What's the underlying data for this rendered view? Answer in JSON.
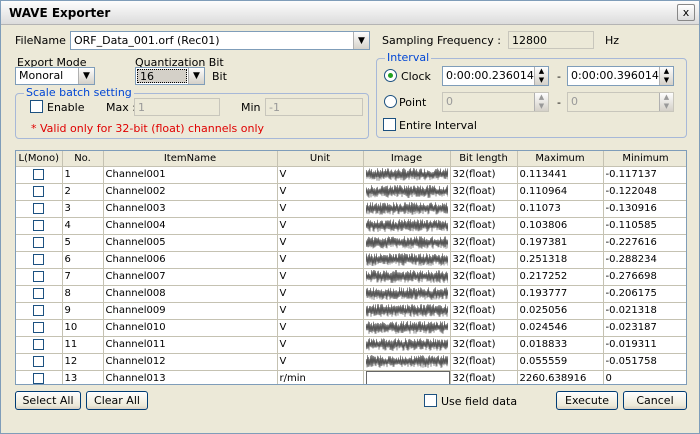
{
  "window": {
    "title": "WAVE Exporter",
    "close_glyph": "x"
  },
  "file": {
    "label": "FileName :",
    "value": "ORF_Data_001.orf (Rec01)"
  },
  "sampling": {
    "label": "Sampling Frequency :",
    "value": "12800",
    "unit": "Hz"
  },
  "export_mode": {
    "label": "Export Mode",
    "value": "Monoral"
  },
  "quant": {
    "label": "Quantization Bit",
    "value": "16",
    "unit": "Bit"
  },
  "scale": {
    "title": "Scale batch setting",
    "enable_label": "Enable",
    "max_label": "Max :",
    "max_value": "1",
    "min_label": "Min :",
    "min_value": "-1",
    "note": "* Valid only for 32-bit (float) channels only"
  },
  "interval": {
    "title": "Interval",
    "clock_label": "Clock",
    "clock_start": "0:00:00.236014",
    "clock_end": "0:00:00.396014",
    "dash": "-",
    "point_label": "Point",
    "point_start": "0",
    "point_end": "0",
    "entire_label": "Entire Interval"
  },
  "table": {
    "headers": [
      "L(Mono)",
      "No.",
      "ItemName",
      "Unit",
      "Image",
      "Bit length",
      "Maximum",
      "Minimum"
    ],
    "rows": [
      {
        "no": "1",
        "name": "Channel001",
        "unit": "V",
        "bits": "32(float)",
        "max": "0.113441",
        "min": "-0.117137"
      },
      {
        "no": "2",
        "name": "Channel002",
        "unit": "V",
        "bits": "32(float)",
        "max": "0.110964",
        "min": "-0.122048"
      },
      {
        "no": "3",
        "name": "Channel003",
        "unit": "V",
        "bits": "32(float)",
        "max": "0.11073",
        "min": "-0.130916"
      },
      {
        "no": "4",
        "name": "Channel004",
        "unit": "V",
        "bits": "32(float)",
        "max": "0.103806",
        "min": "-0.110585"
      },
      {
        "no": "5",
        "name": "Channel005",
        "unit": "V",
        "bits": "32(float)",
        "max": "0.197381",
        "min": "-0.227616"
      },
      {
        "no": "6",
        "name": "Channel006",
        "unit": "V",
        "bits": "32(float)",
        "max": "0.251318",
        "min": "-0.288234"
      },
      {
        "no": "7",
        "name": "Channel007",
        "unit": "V",
        "bits": "32(float)",
        "max": "0.217252",
        "min": "-0.276698"
      },
      {
        "no": "8",
        "name": "Channel008",
        "unit": "V",
        "bits": "32(float)",
        "max": "0.193777",
        "min": "-0.206175"
      },
      {
        "no": "9",
        "name": "Channel009",
        "unit": "V",
        "bits": "32(float)",
        "max": "0.025056",
        "min": "-0.021318"
      },
      {
        "no": "10",
        "name": "Channel010",
        "unit": "V",
        "bits": "32(float)",
        "max": "0.024546",
        "min": "-0.023187"
      },
      {
        "no": "11",
        "name": "Channel011",
        "unit": "V",
        "bits": "32(float)",
        "max": "0.018833",
        "min": "-0.019311"
      },
      {
        "no": "12",
        "name": "Channel012",
        "unit": "V",
        "bits": "32(float)",
        "max": "0.055559",
        "min": "-0.051758"
      },
      {
        "no": "13",
        "name": "Channel013",
        "unit": "r/min",
        "bits": "32(float)",
        "max": "2260.638916",
        "min": "0"
      }
    ]
  },
  "footer": {
    "select_all": "Select All",
    "clear_all": "Clear All",
    "use_field": "Use field data",
    "execute": "Execute",
    "cancel": "Cancel"
  },
  "icons": {
    "dropdown": "chevron-down-icon",
    "spin_up": "spin-up-icon",
    "spin_down": "spin-down-icon"
  }
}
